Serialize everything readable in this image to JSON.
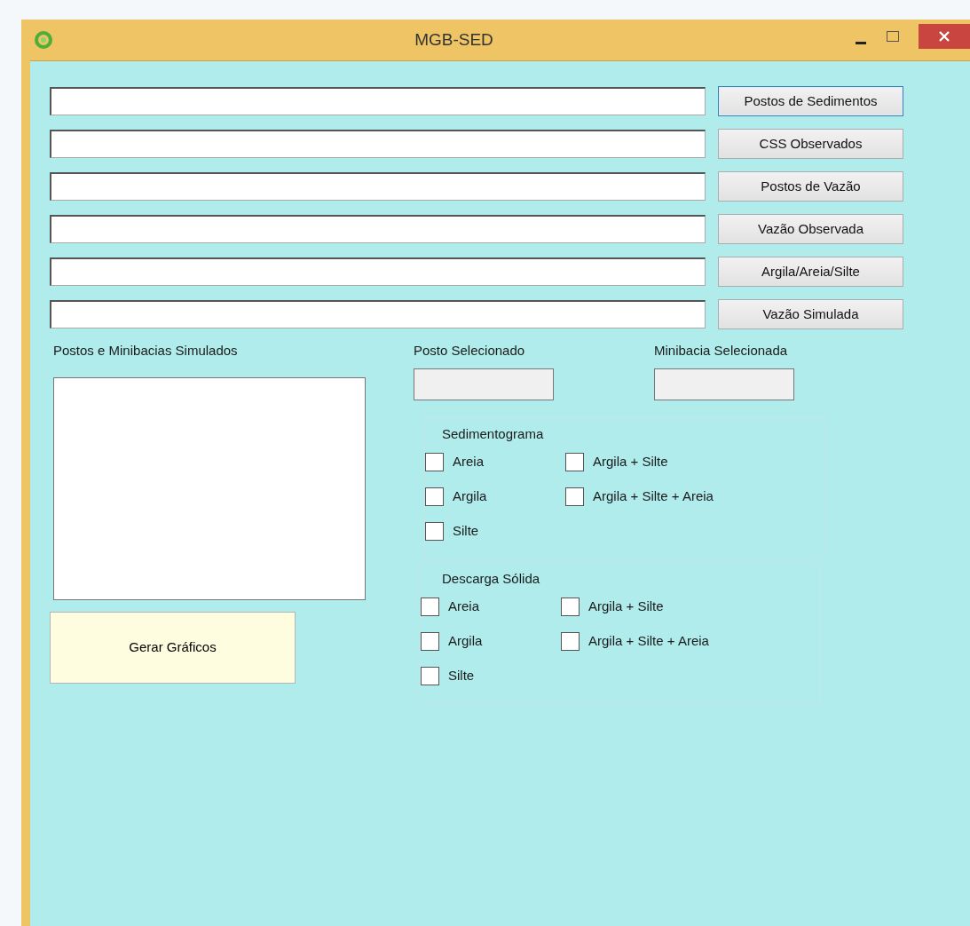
{
  "window": {
    "title": "MGB-SED"
  },
  "file_rows": [
    {
      "button": "Postos de Sedimentos",
      "focused": true
    },
    {
      "button": "CSS Observados",
      "focused": false
    },
    {
      "button": "Postos de Vazão",
      "focused": false
    },
    {
      "button": "Vazão Observada",
      "focused": false
    },
    {
      "button": "Argila/Areia/Silte",
      "focused": false
    },
    {
      "button": "Vazão Simulada",
      "focused": false
    }
  ],
  "list_label": "Postos e Minibacias Simulados",
  "generate_button": "Gerar Gráficos",
  "selected_fields": [
    {
      "label": "Posto Selecionado"
    },
    {
      "label": "Minibacia Selecionada"
    }
  ],
  "groups": [
    {
      "title": "Sedimentograma",
      "options": [
        {
          "label": "Areia",
          "checked": false
        },
        {
          "label": "Argila",
          "checked": false
        },
        {
          "label": "Silte",
          "checked": false
        },
        {
          "label": "Argila + Silte",
          "checked": false
        },
        {
          "label": "Argila + Silte + Areia",
          "checked": false
        }
      ]
    },
    {
      "title": "Descarga Sólida",
      "options": [
        {
          "label": "Areia",
          "checked": false
        },
        {
          "label": "Argila",
          "checked": false
        },
        {
          "label": "Silte",
          "checked": false
        },
        {
          "label": "Argila + Silte",
          "checked": false
        },
        {
          "label": "Argila + Silte + Areia",
          "checked": false
        }
      ]
    }
  ]
}
